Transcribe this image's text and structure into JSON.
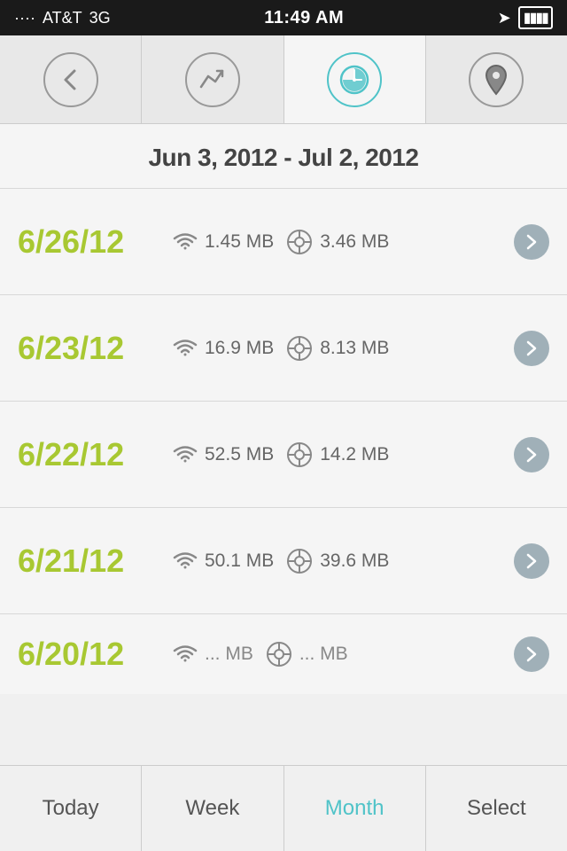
{
  "statusBar": {
    "carrier": "AT&T",
    "network": "3G",
    "time": "11:49 AM",
    "signal": "····",
    "battery": "▮▮▮▮"
  },
  "topNav": {
    "items": [
      {
        "id": "back",
        "label": "Back",
        "icon": "back-arrow",
        "active": false
      },
      {
        "id": "chart",
        "label": "Chart",
        "icon": "chart-arrow",
        "active": false
      },
      {
        "id": "clock",
        "label": "Clock",
        "icon": "clock",
        "active": true
      },
      {
        "id": "location",
        "label": "Location",
        "icon": "location-pin",
        "active": false
      }
    ]
  },
  "dateRange": {
    "text": "Jun 3, 2012 - Jul 2, 2012"
  },
  "dataRows": [
    {
      "date": "6/26/12",
      "wifi": "1.45 MB",
      "cell": "3.46 MB"
    },
    {
      "date": "6/23/12",
      "wifi": "16.9 MB",
      "cell": "8.13 MB"
    },
    {
      "date": "6/22/12",
      "wifi": "52.5 MB",
      "cell": "14.2 MB"
    },
    {
      "date": "6/21/12",
      "wifi": "50.1 MB",
      "cell": "39.6 MB"
    }
  ],
  "partialRow": {
    "date": "6/20/12",
    "wifi": "...",
    "cell": "..."
  },
  "bottomTabs": [
    {
      "id": "today",
      "label": "Today",
      "active": false
    },
    {
      "id": "week",
      "label": "Week",
      "active": false
    },
    {
      "id": "month",
      "label": "Month",
      "active": true
    },
    {
      "id": "select",
      "label": "Select",
      "active": false
    }
  ]
}
